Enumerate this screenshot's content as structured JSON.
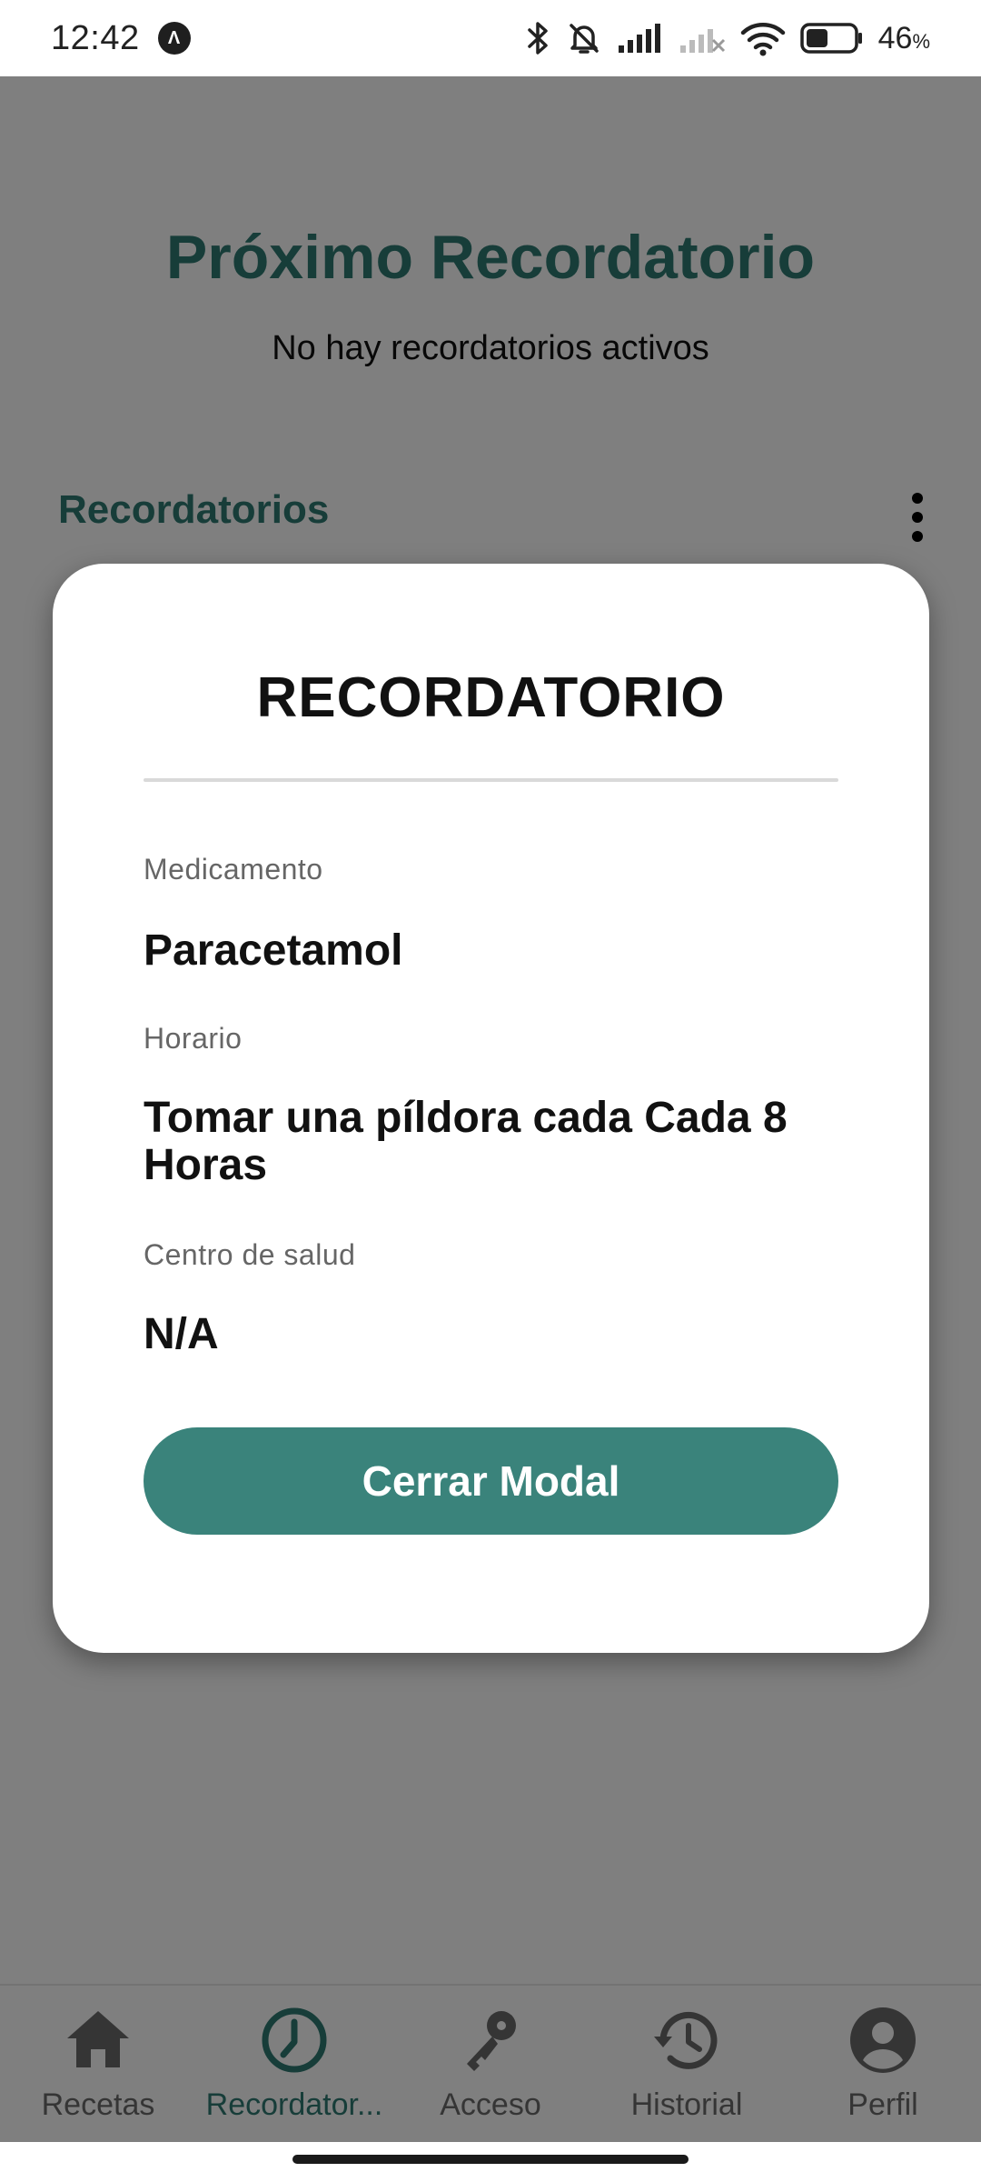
{
  "status_bar": {
    "time": "12:42",
    "app_badge": "Λ",
    "battery_percent": "46",
    "battery_unit": "%",
    "battery_level": 0.46,
    "icons": [
      "bluetooth-icon",
      "bell-off-icon",
      "signal-icon",
      "signal-off-icon",
      "wifi-icon",
      "battery-icon"
    ]
  },
  "screen": {
    "title": "Próximo Recordatorio",
    "subtitle": "No hay recordatorios activos",
    "section_title": "Recordatorios"
  },
  "modal": {
    "title": "RECORDATORIO",
    "fields": [
      {
        "label": "Medicamento",
        "value": "Paracetamol"
      },
      {
        "label": "Horario",
        "value": "Tomar una píldora cada Cada 8 Horas"
      },
      {
        "label": "Centro de salud",
        "value": "N/A"
      }
    ],
    "close_label": "Cerrar Modal"
  },
  "bottom_nav": {
    "items": [
      {
        "label": "Recetas",
        "icon": "home-icon",
        "active": false
      },
      {
        "label": "Recordator...",
        "icon": "clock-icon",
        "active": true
      },
      {
        "label": "Acceso",
        "icon": "key-icon",
        "active": false
      },
      {
        "label": "Historial",
        "icon": "history-icon",
        "active": false
      },
      {
        "label": "Perfil",
        "icon": "profile-icon",
        "active": false
      }
    ]
  },
  "colors": {
    "accent": "#2e7a72",
    "button": "#3a837b",
    "overlay": "#7d7d7d"
  }
}
